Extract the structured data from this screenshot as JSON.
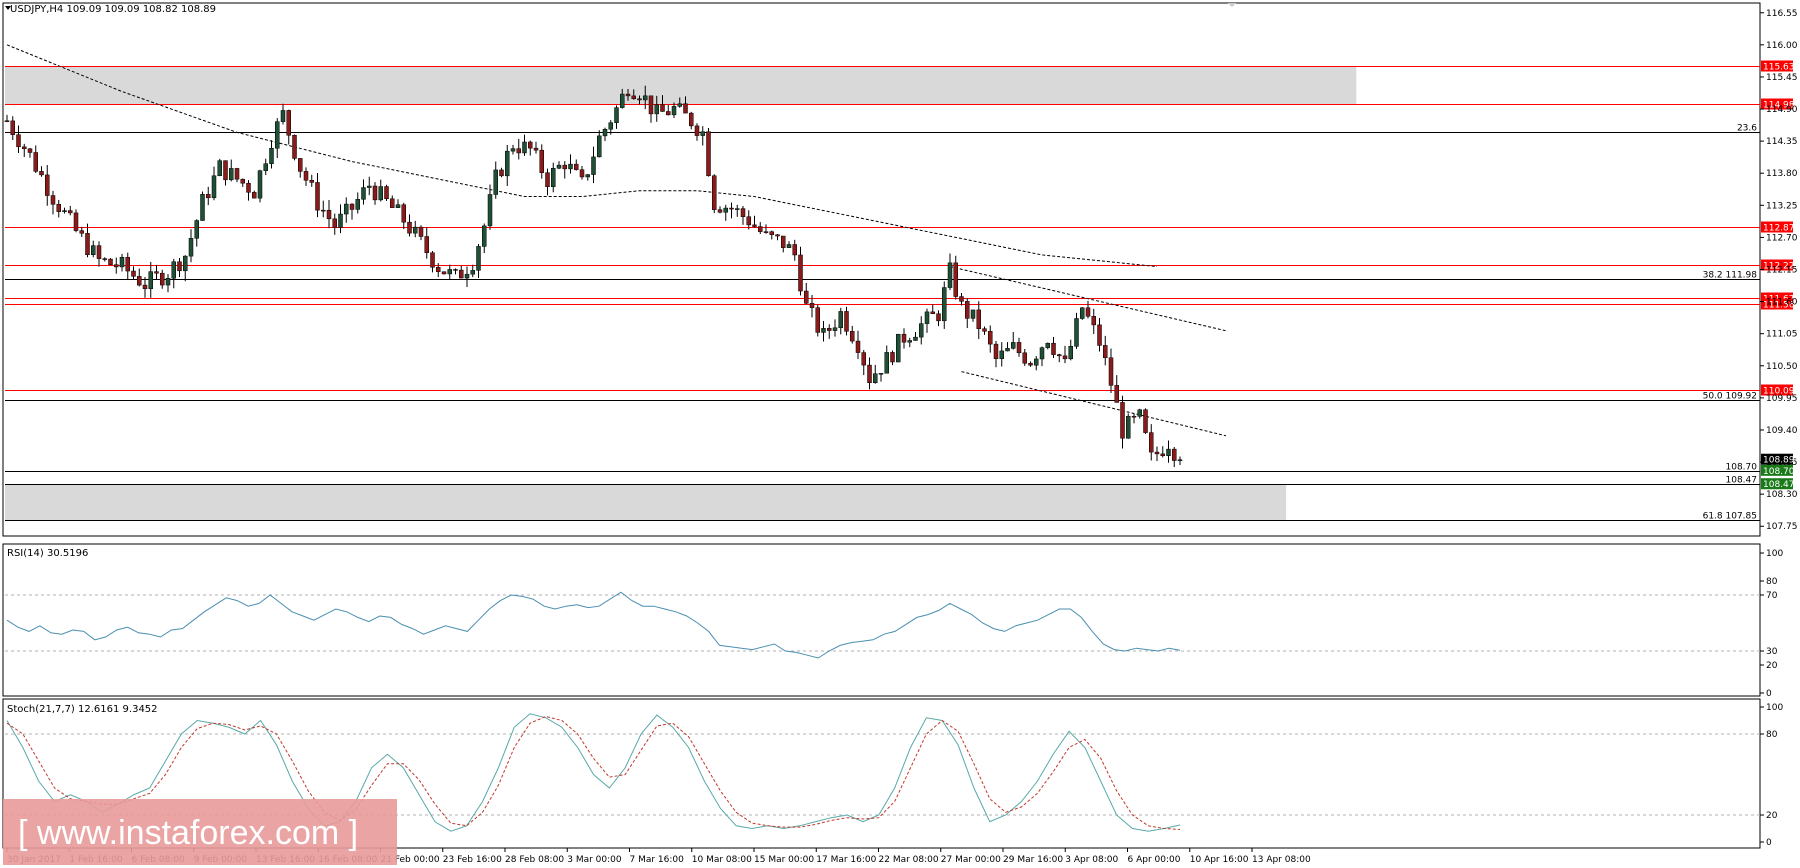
{
  "header": {
    "symbol_line": "USDJPY,H4  109.09 109.09 108.82 108.89"
  },
  "watermark": "[ www.instaforex.com ]",
  "colors": {
    "up": "#1f4f35",
    "down": "#8b1a1a",
    "wick": "#000000",
    "level_red": "#ff0000",
    "level_black": "#000000",
    "zone": "#d9d9d9",
    "rsi": "#4a8fb0",
    "stoch_main": "#5aa8a8",
    "stoch_signal": "#c0392b",
    "watermark_bg": "#e89a9a"
  },
  "chart_data": [
    {
      "type": "candlestick",
      "title": "USDJPY,H4",
      "ylim": [
        107.6,
        116.7
      ],
      "y_ticks": [
        "116.55",
        "116.00",
        "115.45",
        "114.90",
        "114.35",
        "113.80",
        "113.25",
        "112.70",
        "112.15",
        "111.60",
        "111.05",
        "110.50",
        "109.95",
        "109.40",
        "108.85",
        "108.30",
        "107.75"
      ],
      "x_ticks": [
        "30 Jan 2017",
        "1 Feb 16:00",
        "6 Feb 08:00",
        "9 Feb 00:00",
        "13 Feb 16:00",
        "16 Feb 08:00",
        "21 Feb 00:00",
        "23 Feb 16:00",
        "28 Feb 08:00",
        "3 Mar 00:00",
        "7 Mar 16:00",
        "10 Mar 08:00",
        "15 Mar 00:00",
        "17 Mar 16:00",
        "22 Mar 08:00",
        "27 Mar 00:00",
        "29 Mar 16:00",
        "3 Apr 08:00",
        "6 Apr 00:00",
        "10 Apr 16:00",
        "13 Apr 08:00"
      ],
      "path_points": [
        [
          0,
          114.7
        ],
        [
          4,
          114.1
        ],
        [
          8,
          113.4
        ],
        [
          12,
          112.8
        ],
        [
          16,
          112.3
        ],
        [
          20,
          112.2
        ],
        [
          24,
          111.9
        ],
        [
          28,
          112.1
        ],
        [
          31,
          112.4
        ],
        [
          34,
          113.3
        ],
        [
          37,
          113.9
        ],
        [
          40,
          113.7
        ],
        [
          43,
          113.5
        ],
        [
          46,
          114.4
        ],
        [
          48,
          114.8
        ],
        [
          51,
          113.9
        ],
        [
          54,
          113.3
        ],
        [
          57,
          112.9
        ],
        [
          60,
          113.2
        ],
        [
          63,
          113.6
        ],
        [
          66,
          113.3
        ],
        [
          69,
          113.0
        ],
        [
          72,
          112.6
        ],
        [
          75,
          112.2
        ],
        [
          78,
          112.0
        ],
        [
          81,
          112.3
        ],
        [
          83,
          112.9
        ],
        [
          85,
          113.7
        ],
        [
          88,
          114.3
        ],
        [
          91,
          114.2
        ],
        [
          94,
          113.7
        ],
        [
          97,
          114.0
        ],
        [
          100,
          113.6
        ],
        [
          103,
          114.4
        ],
        [
          106,
          114.9
        ],
        [
          108,
          115.3
        ],
        [
          110,
          115.2
        ],
        [
          113,
          114.8
        ],
        [
          116,
          114.9
        ],
        [
          119,
          114.7
        ],
        [
          121,
          114.5
        ],
        [
          123,
          113.3
        ],
        [
          126,
          113.2
        ],
        [
          129,
          113.0
        ],
        [
          132,
          112.7
        ],
        [
          135,
          112.6
        ],
        [
          137,
          112.4
        ],
        [
          139,
          111.5
        ],
        [
          142,
          111.0
        ],
        [
          145,
          111.4
        ],
        [
          148,
          110.9
        ],
        [
          150,
          110.3
        ],
        [
          153,
          110.6
        ],
        [
          156,
          111.0
        ],
        [
          159,
          111.2
        ],
        [
          162,
          111.4
        ],
        [
          164,
          112.1
        ],
        [
          166,
          111.5
        ],
        [
          169,
          111.2
        ],
        [
          172,
          110.6
        ],
        [
          175,
          110.8
        ],
        [
          178,
          110.6
        ],
        [
          181,
          111.0
        ],
        [
          184,
          110.5
        ],
        [
          187,
          111.5
        ],
        [
          190,
          110.9
        ],
        [
          192,
          110.2
        ],
        [
          194,
          109.4
        ],
        [
          197,
          109.6
        ],
        [
          199,
          108.9
        ],
        [
          202,
          109.2
        ],
        [
          204,
          108.9
        ]
      ],
      "last_price": 108.89,
      "horizontal_levels": [
        {
          "price": 115.63,
          "label": "115.63",
          "color": "red"
        },
        {
          "price": 114.98,
          "label": "114.98",
          "color": "red"
        },
        {
          "price": 114.5,
          "label": "23.6",
          "color": "black"
        },
        {
          "price": 112.87,
          "label": "112.87",
          "color": "red"
        },
        {
          "price": 112.22,
          "label": "112.22",
          "color": "red"
        },
        {
          "price": 111.98,
          "label": "38.2 111.98",
          "color": "black"
        },
        {
          "price": 111.67,
          "label": "111.67",
          "color": "red"
        },
        {
          "price": 111.56,
          "label": "111.56",
          "color": "red"
        },
        {
          "price": 110.09,
          "label": "110.09",
          "color": "red"
        },
        {
          "price": 109.92,
          "label": "50.0 109.92",
          "color": "black"
        },
        {
          "price": 108.7,
          "label": "108.70",
          "color": "black"
        },
        {
          "price": 108.47,
          "label": "108.47",
          "color": "black"
        },
        {
          "price": 107.85,
          "label": "61.8 107.85",
          "color": "black"
        }
      ],
      "price_badges": [
        {
          "price": 108.89,
          "label": "108.89",
          "bg": "#000000"
        },
        {
          "price": 108.7,
          "label": "108.70",
          "bg": "#1a7a1a"
        },
        {
          "price": 108.47,
          "label": "108.47",
          "bg": "#1a7a1a"
        }
      ],
      "zones": [
        {
          "from": 114.98,
          "to": 115.63,
          "x_end_fraction": 0.77
        },
        {
          "from": 107.85,
          "to": 108.47,
          "x_end_fraction": 0.73
        }
      ],
      "moving_average": [
        [
          0,
          116.0
        ],
        [
          20,
          115.2
        ],
        [
          40,
          114.5
        ],
        [
          60,
          114.0
        ],
        [
          80,
          113.6
        ],
        [
          90,
          113.4
        ],
        [
          100,
          113.4
        ],
        [
          110,
          113.5
        ],
        [
          120,
          113.5
        ],
        [
          130,
          113.4
        ],
        [
          140,
          113.2
        ],
        [
          150,
          113.0
        ],
        [
          160,
          112.8
        ],
        [
          170,
          112.6
        ],
        [
          180,
          112.4
        ],
        [
          190,
          112.3
        ],
        [
          200,
          112.2
        ]
      ],
      "trendlines": [
        {
          "from": [
            164,
            112.2
          ],
          "to": [
            212,
            111.1
          ]
        },
        {
          "from": [
            166,
            110.4
          ],
          "to": [
            212,
            109.3
          ]
        }
      ]
    },
    {
      "type": "line",
      "title": "RSI(14) 30.5196",
      "ylim": [
        0,
        100
      ],
      "y_ticks": [
        "100",
        "80",
        "70",
        "30",
        "20",
        "0"
      ],
      "levels": [
        70,
        30
      ],
      "values": [
        52,
        47,
        44,
        48,
        43,
        42,
        45,
        44,
        38,
        40,
        45,
        47,
        43,
        42,
        40,
        45,
        46,
        52,
        58,
        63,
        68,
        66,
        62,
        64,
        70,
        64,
        58,
        55,
        52,
        56,
        60,
        58,
        54,
        51,
        55,
        54,
        49,
        46,
        42,
        45,
        48,
        46,
        44,
        52,
        60,
        66,
        70,
        69,
        67,
        62,
        60,
        62,
        63,
        61,
        62,
        67,
        72,
        66,
        62,
        62,
        60,
        58,
        55,
        50,
        44,
        34,
        33,
        32,
        31,
        33,
        35,
        30,
        29,
        27,
        25,
        30,
        34,
        36,
        37,
        38,
        42,
        44,
        49,
        54,
        56,
        59,
        64,
        60,
        56,
        50,
        46,
        44,
        48,
        50,
        52,
        56,
        60,
        60,
        54,
        44,
        35,
        31,
        30,
        32,
        31,
        30,
        32,
        30.5
      ]
    },
    {
      "type": "line",
      "title": "Stoch(21,7,7) 12.6161 9.3452",
      "ylim": [
        0,
        100
      ],
      "y_ticks": [
        "100",
        "80",
        "20",
        "0"
      ],
      "levels": [
        80,
        20
      ],
      "series": [
        {
          "name": "12.6161",
          "values": [
            90,
            70,
            45,
            30,
            35,
            30,
            22,
            28,
            35,
            40,
            60,
            80,
            90,
            88,
            85,
            80,
            90,
            72,
            45,
            25,
            12,
            15,
            30,
            55,
            65,
            55,
            35,
            15,
            8,
            12,
            30,
            55,
            85,
            95,
            92,
            85,
            70,
            50,
            40,
            55,
            80,
            94,
            85,
            70,
            45,
            25,
            12,
            10,
            12,
            10,
            12,
            15,
            18,
            20,
            15,
            20,
            40,
            70,
            92,
            90,
            72,
            40,
            15,
            20,
            30,
            45,
            65,
            82,
            70,
            45,
            20,
            10,
            8,
            10,
            12.6
          ]
        },
        {
          "name": "9.3452",
          "values": [
            88,
            80,
            60,
            40,
            32,
            30,
            28,
            28,
            32,
            36,
            50,
            70,
            84,
            88,
            87,
            83,
            86,
            80,
            60,
            38,
            22,
            16,
            24,
            42,
            58,
            58,
            46,
            28,
            14,
            12,
            22,
            42,
            70,
            88,
            93,
            90,
            80,
            62,
            48,
            50,
            68,
            86,
            88,
            78,
            58,
            38,
            22,
            14,
            12,
            11,
            11,
            13,
            16,
            18,
            17,
            18,
            30,
            55,
            80,
            90,
            82,
            58,
            32,
            22,
            26,
            36,
            52,
            70,
            76,
            62,
            38,
            20,
            12,
            10,
            9.3
          ]
        }
      ]
    }
  ]
}
